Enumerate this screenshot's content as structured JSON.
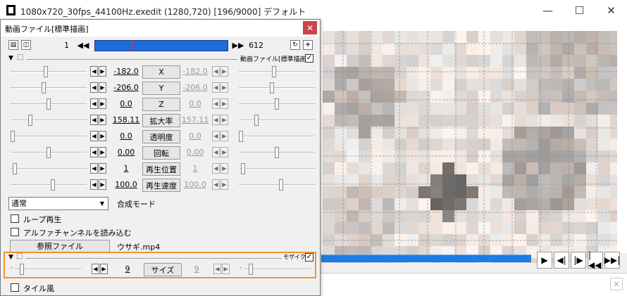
{
  "window": {
    "title": "1080x720_30fps_44100Hz.exedit (1280,720)  [196/9000]  デフォルト",
    "minimize_icon": "—",
    "maximize_icon": "☐",
    "close_icon": "✕"
  },
  "dialog": {
    "title": "動画ファイル[標準描画]",
    "close_icon": "✕",
    "frame_start": "1",
    "frame_end": "612",
    "frame_position": 0.28,
    "object_label": "動画ファイル[標準描画]",
    "object_enabled": "✓",
    "params": [
      {
        "label": "X",
        "left_value": "-182.0",
        "right_value": "-182.0",
        "left_fraction": 0.47,
        "right_fraction": 0.47
      },
      {
        "label": "Y",
        "left_value": "-206.0",
        "right_value": "-206.0",
        "left_fraction": 0.44,
        "right_fraction": 0.44
      },
      {
        "label": "Z",
        "left_value": "0.0",
        "right_value": "0.0",
        "left_fraction": 0.5,
        "right_fraction": 0.5
      },
      {
        "label": "拡大率",
        "left_value": "158.11",
        "right_value": "157.11",
        "left_fraction": 0.25,
        "right_fraction": 0.22
      },
      {
        "label": "透明度",
        "left_value": "0.0",
        "right_value": "0.0",
        "left_fraction": 0.0,
        "right_fraction": 0.0
      },
      {
        "label": "回転",
        "left_value": "0.00",
        "right_value": "0.00",
        "left_fraction": 0.5,
        "right_fraction": 0.5
      },
      {
        "label": "再生位置",
        "left_value": "1",
        "right_value": "1",
        "left_fraction": 0.03,
        "right_fraction": 0.03
      },
      {
        "label": "再生速度",
        "left_value": "100.0",
        "right_value": "100.0",
        "left_fraction": 0.56,
        "right_fraction": 0.56
      }
    ],
    "blend_mode": "通常",
    "blend_label": "合成モード",
    "loop_label": "ループ再生",
    "alpha_label": "アルファチャンネルを読み込む",
    "ref_file_button": "参照ファイル",
    "ref_file_name": "ウサギ.mp4",
    "unchecked": ""
  },
  "mosaic": {
    "label": "モザイク",
    "enabled": "✓",
    "param_label": "サイズ",
    "left_value": "9",
    "right_value": "9",
    "left_fraction": 0.08,
    "right_fraction": 0.08,
    "tile_label": "タイル風"
  },
  "playback": {
    "buttons": [
      "▶",
      "◀|",
      "|▶",
      "|◀◀",
      "▶▶|"
    ]
  },
  "colors": {
    "seekbar": "#1c7be6",
    "highlight": "#f5922d",
    "dialog_close": "#c8464a"
  }
}
